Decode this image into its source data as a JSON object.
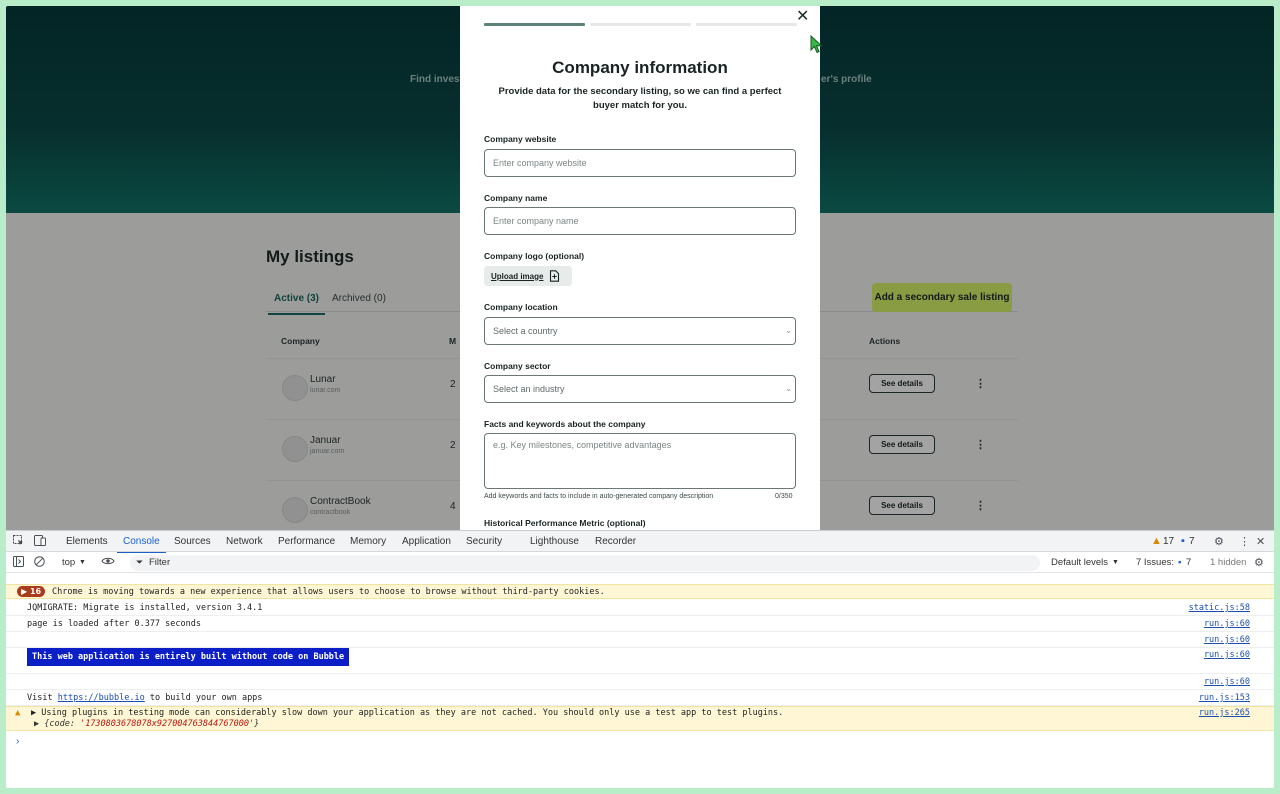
{
  "page": {
    "hero_left_text": "Find invest",
    "hero_right_text": "er's profile",
    "listings_title": "My listings",
    "tabs": [
      {
        "label": "Active (3)"
      },
      {
        "label": "Archived (0)"
      }
    ],
    "add_button": "Add a secondary sale listing",
    "table_headers": {
      "company": "Company",
      "m": "M",
      "actions": "Actions"
    },
    "rows": [
      {
        "name": "Lunar",
        "sub": "lunar.com",
        "num": "2",
        "details": "See details",
        "kebab": "⋮"
      },
      {
        "name": "Januar",
        "sub": "januar.com",
        "num": "2",
        "details": "See details",
        "kebab": "⋮"
      },
      {
        "name": "ContractBook",
        "sub": "contractbook",
        "num": "4",
        "details": "See details",
        "kebab": "⋮"
      }
    ]
  },
  "modal": {
    "close": "✕",
    "title": "Company information",
    "subtitle": "Provide data for the secondary listing, so we can find a perfect buyer match for you.",
    "website_label": "Company website",
    "website_placeholder": "Enter company website",
    "name_label": "Company name",
    "name_placeholder": "Enter company name",
    "logo_label": "Company logo (optional)",
    "upload_label": "Upload image",
    "location_label": "Company location",
    "location_value": "Select a country",
    "sector_label": "Company sector",
    "sector_value": "Select an industry",
    "facts_label": "Facts and keywords about the company",
    "facts_placeholder": "e.g. Key milestones, competitive advantages",
    "facts_help": "Add keywords and facts to include in auto-generated company description",
    "facts_counter": "0/350",
    "metric_label": "Historical Performance Metric (optional)",
    "progress_step": 1,
    "progress_total": 3
  },
  "devtools": {
    "tabs": [
      "Elements",
      "Console",
      "Sources",
      "Network",
      "Performance",
      "Memory",
      "Application",
      "Security",
      "Lighthouse",
      "Recorder"
    ],
    "active_tab": "Console",
    "warnings_count": "17",
    "messages_count": "7",
    "context": "top",
    "filter_label": "Filter",
    "levels": "Default levels",
    "issues_label": "7 Issues:",
    "issues_count": "7",
    "hidden": "1 hidden",
    "logs": {
      "cookies_count": "16",
      "cookies_msg": "Chrome is moving towards a new experience that allows users to choose to browse without third-party cookies.",
      "jqmigrate": "JQMIGRATE: Migrate is installed, version 3.4.1",
      "jqmigrate_src": "static.js:58",
      "loaded": "page is loaded after 0.377 seconds",
      "loaded_src": "run.js:60",
      "blank_src": "run.js:60",
      "bubble_badge": "This web application is entirely built without code on Bubble",
      "bubble_src": "run.js:60",
      "blank2_src": "run.js:60",
      "visit_prefix": "Visit ",
      "visit_link": "https://bubble.io",
      "visit_suffix": " to build your own apps",
      "visit_src": "run.js:153",
      "plugin_warn": "Using plugins in testing mode can considerably slow down your application as they are not cached. You should only use a test app to test plugins.",
      "plugin_src": "run.js:265",
      "obj_prefix": "{code: ",
      "obj_value": "'1730803678078x927004763844767000'",
      "obj_suffix": "}"
    }
  }
}
